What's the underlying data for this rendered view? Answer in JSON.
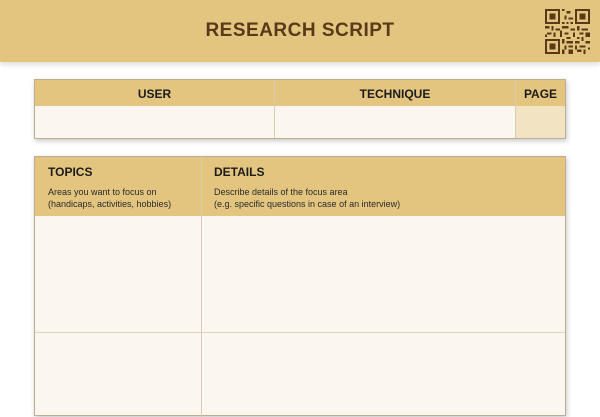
{
  "header": {
    "title": "RESEARCH SCRIPT",
    "qr_icon": "qr-code-icon"
  },
  "meta_table": {
    "columns": [
      "USER",
      "TECHNIQUE",
      "PAGE"
    ],
    "values": [
      "",
      "",
      ""
    ]
  },
  "main_table": {
    "columns": [
      {
        "title": "TOPICS",
        "hint_lines": [
          "Areas you want to focus on",
          "(handicaps, activities, hobbies)"
        ]
      },
      {
        "title": "DETAILS",
        "hint_lines": [
          "Describe details of the focus area",
          "(e.g. specific questions in case of an interview)"
        ]
      }
    ]
  },
  "colors": {
    "header_band": "#e3c57f",
    "title_text": "#5a3818",
    "card_background": "#fbf6ee",
    "page_cell": "#f2e4c2"
  }
}
